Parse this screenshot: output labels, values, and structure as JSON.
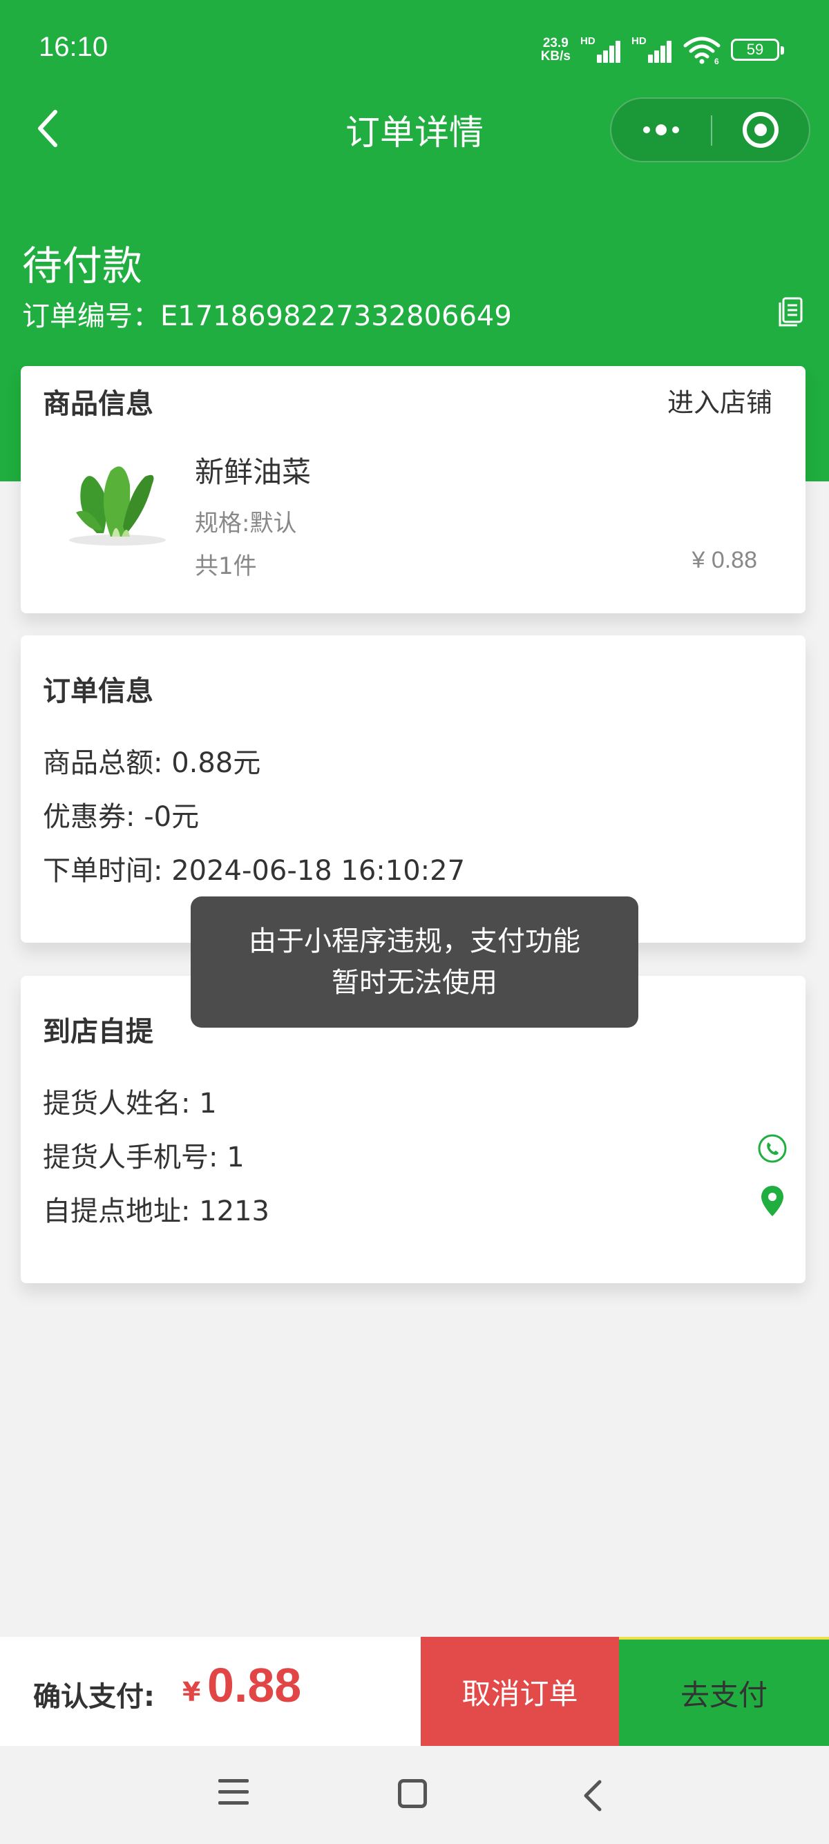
{
  "status_bar": {
    "time": "16:10",
    "net_speed_value": "23.9",
    "net_speed_unit": "KB/s",
    "sim1_label": "HD",
    "sim2_label": "HD",
    "wifi_sub": "6",
    "battery": "59"
  },
  "nav": {
    "title": "订单详情"
  },
  "order": {
    "status": "待付款",
    "order_no_label": "订单编号：",
    "order_no": "E171869822733 2806649"
  },
  "goods_card": {
    "title": "商品信息",
    "enter_shop": "进入店铺",
    "item": {
      "name": "新鲜油菜",
      "spec": "规格:默认",
      "count": "共1件",
      "price": "¥ 0.88"
    }
  },
  "order_info": {
    "title": "订单信息",
    "lines": [
      "商品总额: 0.88元",
      "优惠券: -0元",
      "下单时间: 2024-06-18 16:10:27"
    ]
  },
  "pickup": {
    "title": "到店自提",
    "name_line": "提货人姓名: 1",
    "phone_line": "提货人手机号: 1",
    "address_line": "自提点地址: 1213"
  },
  "toast": {
    "line1": "由于小程序违规，支付功能",
    "line2": "暂时无法使用"
  },
  "bottom": {
    "confirm_label": "确认支付:",
    "currency": "¥",
    "total": "0.88",
    "cancel_label": "取消订单",
    "pay_label": "去支付"
  },
  "colors": {
    "primary_green": "#1fae3f",
    "price_red": "#e24545",
    "cancel_red": "#e34a4a"
  },
  "icons": [
    "back-arrow-icon",
    "more-dots-icon",
    "close-target-icon",
    "copy-icon",
    "phone-icon",
    "location-pin-icon",
    "menu-icon",
    "home-icon",
    "back-icon"
  ]
}
